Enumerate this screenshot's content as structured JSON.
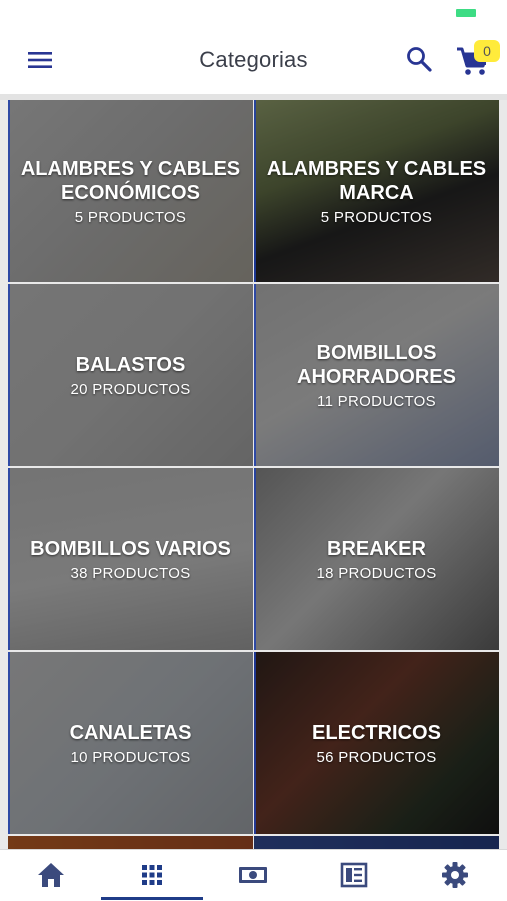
{
  "header": {
    "title": "Categorias",
    "cart_count": "0",
    "icons": [
      "menu-icon",
      "search-icon",
      "cart-icon"
    ],
    "accent_color": "#283593",
    "badge_color": "#ffeb3b"
  },
  "categories": [
    {
      "name": "ALAMBRES Y CABLES ECONÓMICOS",
      "count": "5 PRODUCTOS"
    },
    {
      "name": "ALAMBRES Y CABLES MARCA",
      "count": "5 PRODUCTOS"
    },
    {
      "name": "BALASTOS",
      "count": "20 PRODUCTOS"
    },
    {
      "name": "BOMBILLOS AHORRADORES",
      "count": "11 PRODUCTOS"
    },
    {
      "name": "BOMBILLOS VARIOS",
      "count": "38 PRODUCTOS"
    },
    {
      "name": "BREAKER",
      "count": "18 PRODUCTOS"
    },
    {
      "name": "CANALETAS",
      "count": "10 PRODUCTOS"
    },
    {
      "name": "ELECTRICOS",
      "count": "56 PRODUCTOS"
    }
  ],
  "bottom_nav": {
    "items": [
      "home-icon",
      "grid-icon",
      "money-icon",
      "catalog-icon",
      "settings-icon"
    ],
    "active": "grid-icon"
  }
}
